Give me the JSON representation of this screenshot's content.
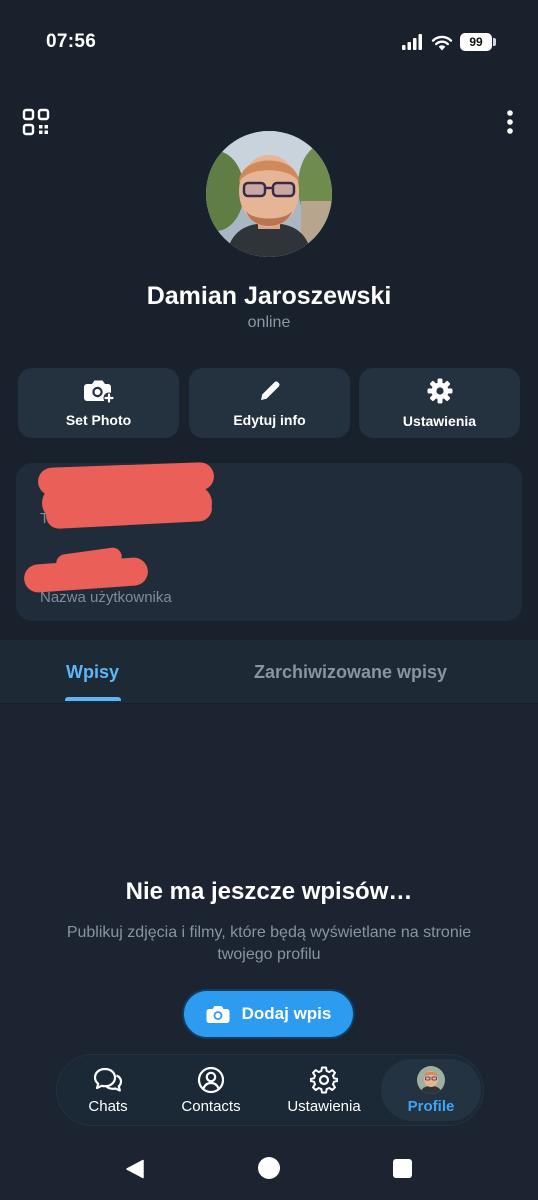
{
  "status_bar": {
    "time": "07:56",
    "battery": "99",
    "icons": [
      "signal-icon",
      "wifi-icon",
      "battery-icon"
    ]
  },
  "header": {
    "qr_icon": "qr-code-icon",
    "menu_icon": "more-vertical-icon"
  },
  "profile": {
    "name": "Damian Jaroszewski",
    "status": "online"
  },
  "actions": [
    {
      "label": "Set Photo",
      "icon": "camera-add-icon"
    },
    {
      "label": "Edytuj info",
      "icon": "pencil-icon"
    },
    {
      "label": "Ustawienia",
      "icon": "gear-icon"
    }
  ],
  "info": {
    "phone_label": "Telefon",
    "username_label": "Nazwa użytkownika"
  },
  "tabs": [
    {
      "label": "Wpisy",
      "active": true
    },
    {
      "label": "Zarchiwizowane wpisy",
      "active": false
    }
  ],
  "empty_state": {
    "title": "Nie ma jeszcze wpisów…",
    "description": "Publikuj zdjęcia i filmy, które będą wyświetlane na stronie twojego profilu",
    "button_label": "Dodaj wpis"
  },
  "bottom_nav": [
    {
      "label": "Chats",
      "icon": "chat-bubbles-icon"
    },
    {
      "label": "Contacts",
      "icon": "user-circle-icon"
    },
    {
      "label": "Ustawienia",
      "icon": "gear-icon"
    },
    {
      "label": "Profile",
      "icon": "avatar-icon",
      "active": true
    }
  ],
  "colors": {
    "accent": "#5eb5f7",
    "button": "#2d9cf0",
    "background": "#18212c",
    "redaction": "#ea5f57"
  }
}
